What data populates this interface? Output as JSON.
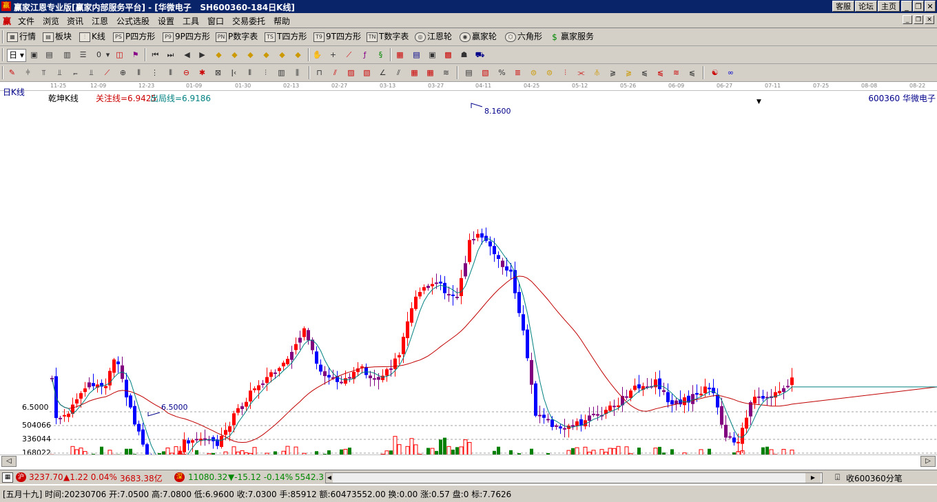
{
  "window": {
    "app_icon": "赢",
    "title": "赢家江恩专业版[赢家内部服务平台] - [华微电子   SH600360-184日K线]",
    "buttons": [
      "客服",
      "论坛",
      "主页"
    ],
    "controls": [
      "_",
      "❐",
      "✕"
    ]
  },
  "menu": {
    "icon": "赢",
    "items": [
      "文件",
      "浏览",
      "资讯",
      "江恩",
      "公式选股",
      "设置",
      "工具",
      "窗口",
      "交易委托",
      "帮助"
    ],
    "controls": [
      "_",
      "❐",
      "✕"
    ]
  },
  "toolbar1": {
    "items": [
      {
        "icon": "grid-icon",
        "glyph": "▦",
        "label": "行情"
      },
      {
        "icon": "blocks-icon",
        "glyph": "▤",
        "label": "板块"
      },
      {
        "icon": "kline-icon",
        "glyph": "⫶",
        "label": "K线"
      },
      {
        "icon": "p-square-icon",
        "glyph": "PS",
        "label": "P四方形"
      },
      {
        "icon": "p9-icon",
        "glyph": "P9",
        "label": "9P四方形"
      },
      {
        "icon": "pn-icon",
        "glyph": "PN",
        "label": "P数字表"
      },
      {
        "icon": "ts-icon",
        "glyph": "TS",
        "label": "T四方形"
      },
      {
        "icon": "t9-icon",
        "glyph": "T9",
        "label": "9T四方形"
      },
      {
        "icon": "tn-icon",
        "glyph": "TN",
        "label": "T数字表"
      },
      {
        "icon": "gann-wheel-icon",
        "glyph": "◎",
        "label": "江恩轮"
      },
      {
        "icon": "winner-wheel-icon",
        "glyph": "◉",
        "label": "赢家轮"
      },
      {
        "icon": "hexagon-icon",
        "glyph": "⬡",
        "label": "六角形"
      },
      {
        "icon": "dollar-icon",
        "glyph": "$",
        "label": "赢家服务"
      }
    ]
  },
  "toolbar2": {
    "period": "日",
    "zero": "0"
  },
  "chart": {
    "period_label": "日K线",
    "indicator_name": "乾坤K线",
    "focus_line": "关注线=6.9425",
    "exit_line": "出局线=6.9186",
    "stock_label": "600360 华微电子",
    "high_label": "8.1600",
    "low_label": "6.5000",
    "price_axis": "6.5000",
    "vol_labels": [
      "504066",
      "336044",
      "168022"
    ],
    "dates": [
      "11-25",
      "12-09",
      "12-23",
      "01-09",
      "01-30",
      "02-13",
      "02-27",
      "03-13",
      "03-27",
      "04-11",
      "04-25",
      "05-12",
      "05-26",
      "06-09",
      "06-27",
      "07-11",
      "07-25",
      "08-08",
      "08-22"
    ],
    "colors": {
      "up": "#ff0000",
      "down": "#0000ff",
      "flat": "#800080",
      "ma_short": "#008080",
      "ma_long": "#c00000",
      "vol_up": "#ff0000",
      "vol_down": "#008000"
    }
  },
  "status": {
    "sh_icon": "沪",
    "sh_index": "3237.70",
    "sh_change": "▲1.22 0.04%",
    "sh_amount": "3683.38亿",
    "sz_icon": "深",
    "sz_index": "11080.32",
    "sz_change": "▼-15.12 -0.14%",
    "sz_amount": "5542.3",
    "right_text": "收600360分笔"
  },
  "info": {
    "text": "[五月十九] 时间:20230706 开:7.0500 高:7.0800 低:6.9600 收:7.0300 手:85912 额:60473552.00 换:0.00 涨:0.57 盘:0 标:7.7626"
  }
}
